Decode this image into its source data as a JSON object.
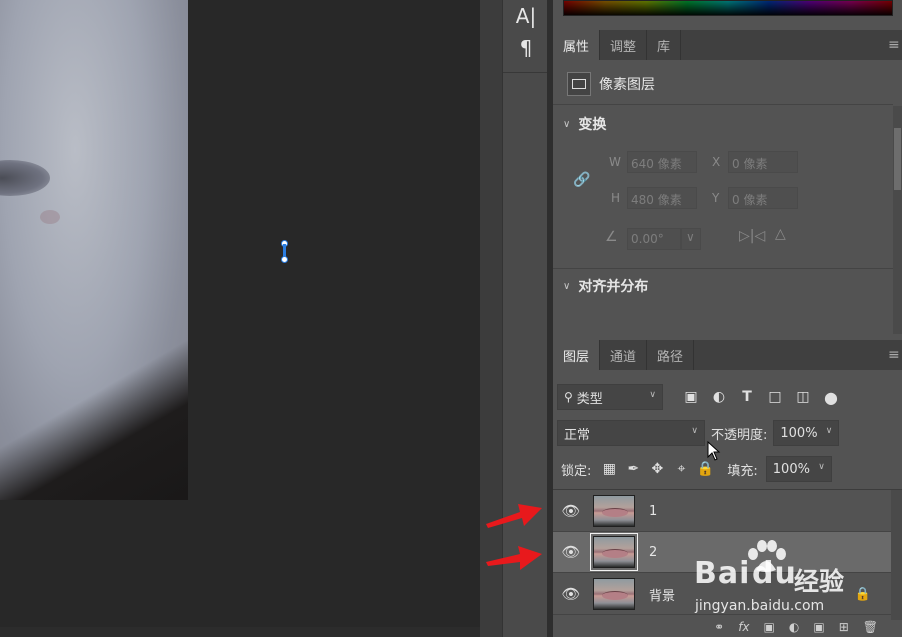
{
  "toolbar": {
    "tool_text": "A|",
    "tool_paragraph": "¶"
  },
  "properties": {
    "tabs": [
      "属性",
      "调整",
      "库"
    ],
    "menu_icon": "≡",
    "layer_type": "像素图层",
    "transform_title": "变换",
    "w_label": "W",
    "w_value": "640 像素",
    "x_label": "X",
    "x_value": "0 像素",
    "h_label": "H",
    "h_value": "480 像素",
    "y_label": "Y",
    "y_value": "0 像素",
    "angle_value": "0.00°",
    "align_title": "对齐并分布"
  },
  "layers": {
    "tabs": [
      "图层",
      "通道",
      "路径"
    ],
    "filter_kind": "类型",
    "blend_mode": "正常",
    "opacity_label": "不透明度:",
    "opacity_value": "100%",
    "lock_label": "锁定:",
    "fill_label": "填充:",
    "fill_value": "100%",
    "items": [
      {
        "name": "1",
        "selected": false,
        "locked": false
      },
      {
        "name": "2",
        "selected": true,
        "locked": false
      },
      {
        "name": "背景",
        "selected": false,
        "locked": true
      }
    ],
    "footer_fx": "fx"
  },
  "watermark": {
    "brand": "Bai",
    "brand_tail": "du",
    "brand_cn": "经验",
    "url": "jingyan.baidu.com"
  },
  "colors": {
    "annotation_arrow": "#e8191c",
    "selection_accent": "#2a7de1"
  }
}
